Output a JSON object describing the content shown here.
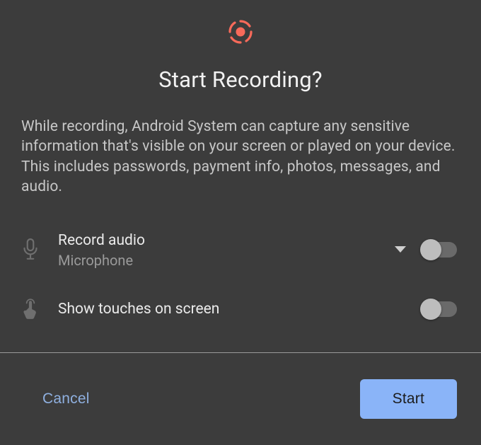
{
  "dialog": {
    "title": "Start Recording?",
    "warning": "While recording, Android System can capture any sensitive information that's visible on your screen or played on your device. This includes passwords, payment info, photos, messages, and audio."
  },
  "options": {
    "audio": {
      "label": "Record audio",
      "source": "Microphone",
      "enabled": false
    },
    "touches": {
      "label": "Show touches on screen",
      "enabled": false
    }
  },
  "actions": {
    "cancel": "Cancel",
    "start": "Start"
  },
  "colors": {
    "accent": "#8ab4f8",
    "record_icon": "#f86a5a",
    "background": "#3c3c3c"
  }
}
